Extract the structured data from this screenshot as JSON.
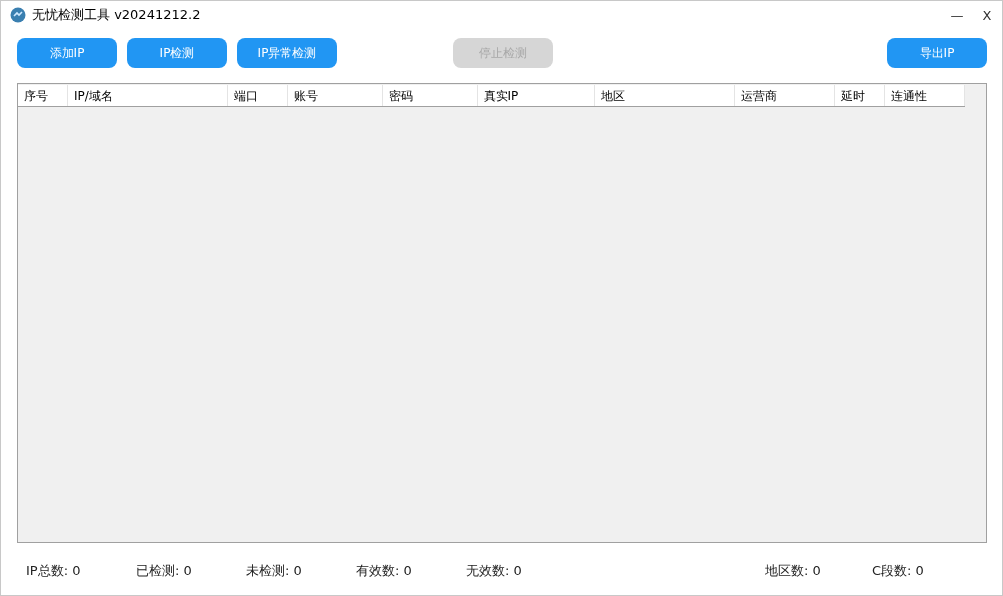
{
  "window": {
    "title": "无忧检测工具 v20241212.2",
    "minimize": "—",
    "close": "X"
  },
  "toolbar": [
    {
      "label": "添加IP",
      "disabled": false
    },
    {
      "label": "IP检测",
      "disabled": false
    },
    {
      "label": "IP异常检测",
      "disabled": false
    },
    {
      "label": "停止检测",
      "disabled": true
    },
    {
      "label": "导出IP",
      "disabled": false
    }
  ],
  "table": {
    "columns": [
      "序号",
      "IP/域名",
      "端口",
      "账号",
      "密码",
      "真实IP",
      "地区",
      "运营商",
      "延时",
      "连通性"
    ]
  },
  "status_bar": {
    "left": [
      "IP总数: 0",
      "已检测: 0",
      "未检测: 0",
      "有效数: 0",
      "无效数: 0"
    ],
    "right": [
      "地区数: 0",
      "C段数: 0"
    ]
  }
}
